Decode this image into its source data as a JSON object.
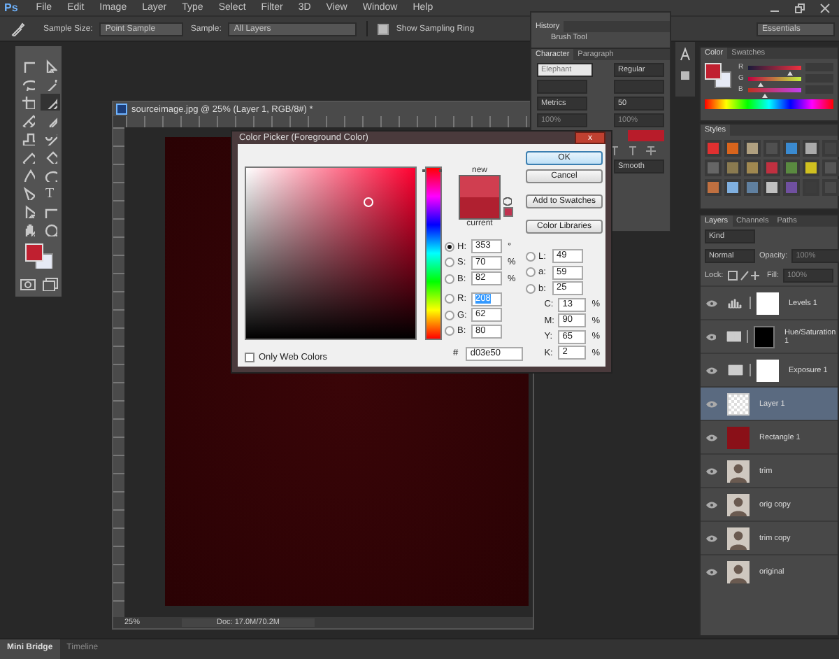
{
  "menu_bar": {
    "logo": "Ps",
    "items": [
      "File",
      "Edit",
      "Image",
      "Layer",
      "Type",
      "Select",
      "Filter",
      "3D",
      "View",
      "Window",
      "Help"
    ]
  },
  "options_bar": {
    "sample_size_label": "Sample Size:",
    "sample_size": "Point Sample",
    "sample_label": "Sample:",
    "sample": "All Layers",
    "sampling_ring": {
      "label": "Show Sampling Ring",
      "checked": true
    },
    "workspace": "Essentials"
  },
  "toolbox": {
    "tools": [
      {
        "kind": "marquee",
        "selected": false
      },
      {
        "kind": "move",
        "selected": false
      },
      {
        "kind": "lasso",
        "selected": false
      },
      {
        "kind": "wand",
        "selected": false
      },
      {
        "kind": "crop",
        "selected": false
      },
      {
        "kind": "eyedropper",
        "selected": true
      },
      {
        "kind": "healing",
        "selected": false
      },
      {
        "kind": "brush",
        "selected": false
      },
      {
        "kind": "stamp",
        "selected": false
      },
      {
        "kind": "history-brush",
        "selected": false
      },
      {
        "kind": "eraser",
        "selected": false
      },
      {
        "kind": "bucket",
        "selected": false
      },
      {
        "kind": "blur",
        "selected": false
      },
      {
        "kind": "dodge",
        "selected": false
      },
      {
        "kind": "pen",
        "selected": false
      },
      {
        "kind": "type",
        "selected": false,
        "glyph": "T"
      },
      {
        "kind": "path-select",
        "selected": false
      },
      {
        "kind": "rectangle",
        "selected": false
      },
      {
        "kind": "hand",
        "selected": false
      },
      {
        "kind": "zoom",
        "selected": false
      }
    ]
  },
  "document": {
    "title": "sourceimage.jpg @ 25% (Layer 1, RGB/8#) *",
    "zoom": "25%",
    "doc_info": "Doc: 17.0M/70.2M"
  },
  "history": {
    "tab": "History",
    "items": [
      "Brush Tool"
    ]
  },
  "character": {
    "tabs": [
      {
        "label": "Character",
        "selected": true
      },
      {
        "label": "Paragraph",
        "selected": false
      }
    ],
    "font_family": "Elephant",
    "font_style": "Regular",
    "kerning": "Metrics",
    "tracking": "50",
    "vertical_scale": "100%",
    "horizontal_scale": "100%",
    "antialias": "Smooth"
  },
  "color_panel": {
    "tabs": [
      {
        "label": "Color",
        "selected": true
      },
      {
        "label": "Swatches",
        "selected": false
      }
    ],
    "channels": [
      {
        "label": "R",
        "level": 0.8
      },
      {
        "label": "G",
        "level": 0.24
      },
      {
        "label": "B",
        "level": 0.31
      }
    ]
  },
  "styles_panel": {
    "title": "Styles"
  },
  "layers_panel": {
    "tabs": [
      {
        "label": "Layers",
        "selected": true
      },
      {
        "label": "Channels",
        "selected": false
      },
      {
        "label": "Paths",
        "selected": false
      }
    ],
    "filter": "Kind",
    "blend_mode": "Normal",
    "opacity_label": "Opacity:",
    "opacity": "100%",
    "lock_label": "Lock:",
    "fill_label": "Fill:",
    "fill": "100%",
    "layers": [
      {
        "name": "Levels 1",
        "kind": "levels",
        "black_mask": false,
        "selected": false
      },
      {
        "name": "Hue/Saturation 1",
        "kind": "hue",
        "black_mask": true,
        "selected": false
      },
      {
        "name": "Exposure 1",
        "kind": "exposure",
        "black_mask": false,
        "selected": false
      },
      {
        "name": "Layer 1",
        "kind": "pixel",
        "selected": true
      },
      {
        "name": "Rectangle 1",
        "kind": "shape",
        "selected": false
      },
      {
        "name": "trim",
        "kind": "photo",
        "selected": false
      },
      {
        "name": "orig copy",
        "kind": "photo",
        "selected": false
      },
      {
        "name": "trim copy",
        "kind": "photo",
        "selected": false
      },
      {
        "name": "original",
        "kind": "photo",
        "selected": false
      }
    ]
  },
  "color_picker": {
    "title": "Color Picker (Foreground Color)",
    "close": "x",
    "new_label": "new",
    "current_label": "current",
    "buttons": [
      {
        "label": "OK",
        "default": true
      },
      {
        "label": "Cancel",
        "default": false
      },
      {
        "label": "Add to Swatches",
        "default": false
      },
      {
        "label": "Color Libraries",
        "default": false
      }
    ],
    "hsb_rgb": [
      {
        "label": "H:",
        "value": "353",
        "unit": "°",
        "selected": true,
        "highlighted": false
      },
      {
        "label": "S:",
        "value": "70",
        "unit": "%",
        "selected": false,
        "highlighted": false
      },
      {
        "label": "B:",
        "value": "82",
        "unit": "%",
        "selected": false,
        "highlighted": false
      },
      {
        "label": "R:",
        "value": "208",
        "selected": false,
        "highlighted": true
      },
      {
        "label": "G:",
        "value": "62",
        "selected": false,
        "highlighted": false
      },
      {
        "label": "B:",
        "value": "80",
        "selected": false,
        "highlighted": false
      }
    ],
    "lab": [
      {
        "label": "L:",
        "value": "49",
        "selected": false
      },
      {
        "label": "a:",
        "value": "59",
        "selected": false
      },
      {
        "label": "b:",
        "value": "25",
        "selected": false
      }
    ],
    "cmyk": [
      {
        "label": "C:",
        "value": "13",
        "unit": "%"
      },
      {
        "label": "M:",
        "value": "90",
        "unit": "%"
      },
      {
        "label": "Y:",
        "value": "65",
        "unit": "%"
      },
      {
        "label": "K:",
        "value": "2",
        "unit": "%"
      }
    ],
    "hue_slider": {
      "level": 0.02
    },
    "hex_label": "#",
    "hex": "d03e50",
    "only_web_colors": {
      "label": "Only Web Colors",
      "checked": false
    }
  },
  "bottom_tabs": [
    {
      "label": "Mini Bridge",
      "selected": true
    },
    {
      "label": "Timeline",
      "selected": false
    }
  ]
}
